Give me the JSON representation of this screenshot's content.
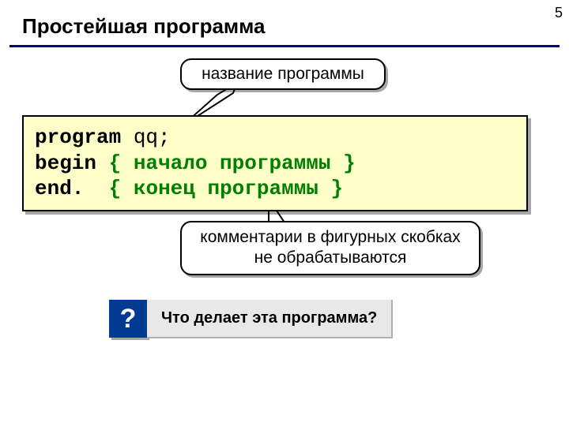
{
  "page_number": "5",
  "title": "Простейшая программа",
  "callouts": {
    "top": "название программы",
    "bottom_line1": "комментарии в фигурных скобках",
    "bottom_line2": "не обрабатываются"
  },
  "code": {
    "line1_kw": "program",
    "line1_rest": " qq;",
    "line2_kw": "begin",
    "line2_brace_open": " { ",
    "line2_comment": "начало программы",
    "line2_brace_close": " }",
    "line3_kw": "end.",
    "line3_pad": "  ",
    "line3_brace_open": "{ ",
    "line3_comment": "конец программы",
    "line3_brace_close": " }"
  },
  "question": {
    "badge": "?",
    "text": "Что делает эта программа?"
  }
}
